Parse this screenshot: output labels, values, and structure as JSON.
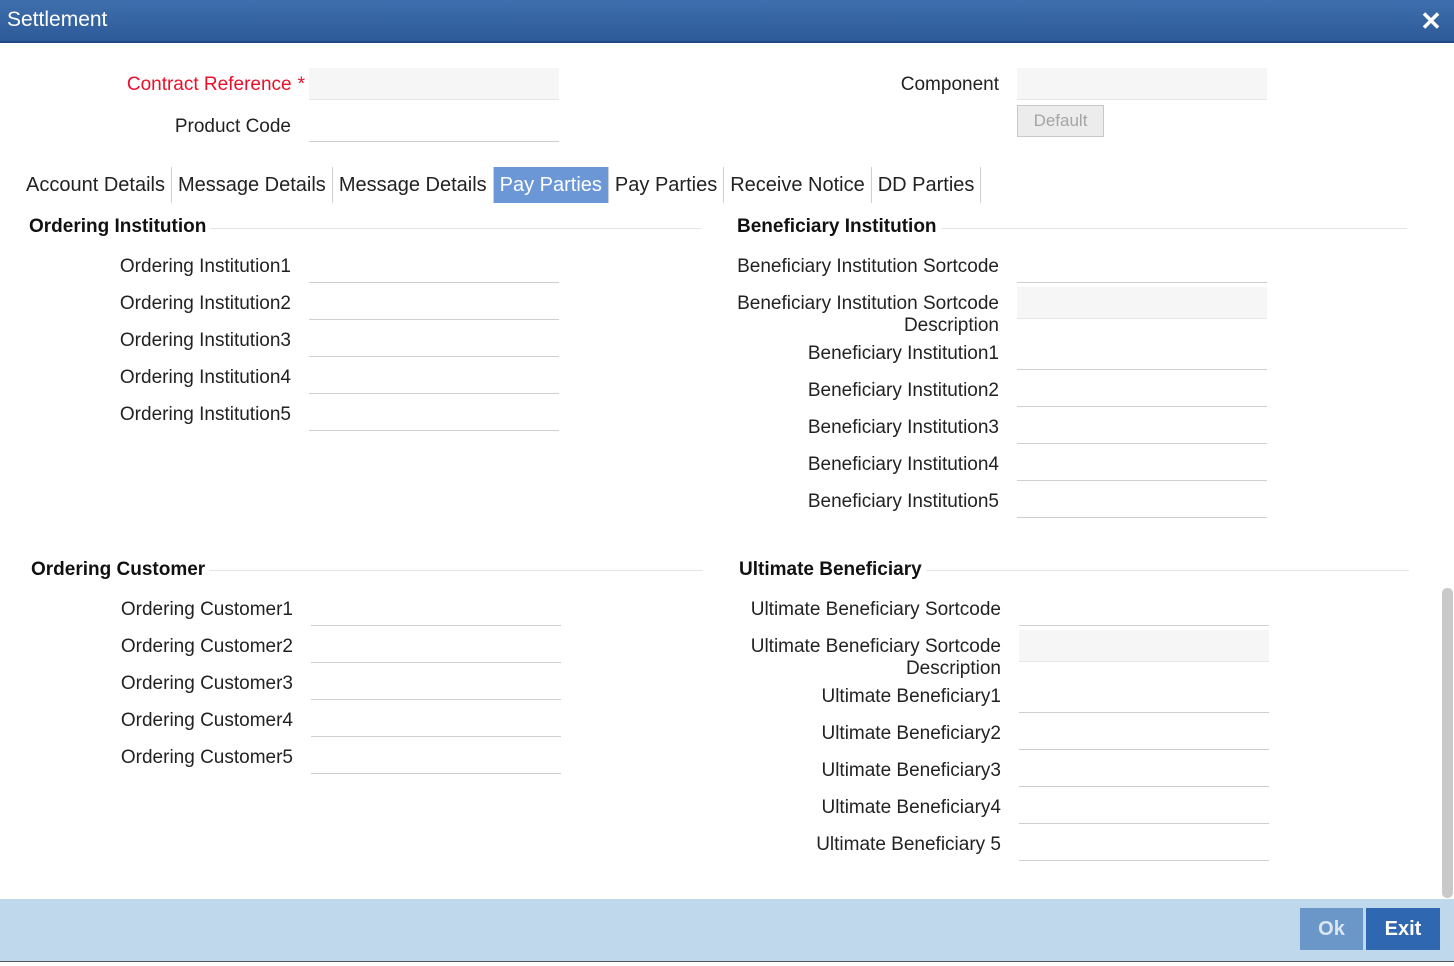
{
  "window": {
    "title": "Settlement",
    "close_glyph": "✕"
  },
  "header": {
    "contract_reference_label": "Contract Reference",
    "required_mark": "*",
    "product_code_label": "Product Code",
    "component_label": "Component",
    "default_button": "Default"
  },
  "tabs": [
    {
      "label": "Account Details"
    },
    {
      "label": "Message Details"
    },
    {
      "label": "Message Details"
    },
    {
      "label": "Pay Parties"
    },
    {
      "label": "Pay Parties"
    },
    {
      "label": "Receive Notice"
    },
    {
      "label": "DD Parties"
    }
  ],
  "ordering_institution": {
    "title": "Ordering Institution",
    "fields": [
      "Ordering Institution1",
      "Ordering Institution2",
      "Ordering Institution3",
      "Ordering Institution4",
      "Ordering Institution5"
    ]
  },
  "beneficiary_institution": {
    "title": "Beneficiary Institution",
    "sortcode": "Beneficiary Institution Sortcode",
    "sortcode_desc_line1": "Beneficiary Institution Sortcode",
    "sortcode_desc_line2": "Description",
    "fields": [
      "Beneficiary Institution1",
      "Beneficiary Institution2",
      "Beneficiary Institution3",
      "Beneficiary Institution4",
      "Beneficiary Institution5"
    ]
  },
  "ordering_customer": {
    "title": "Ordering Customer",
    "fields": [
      "Ordering Customer1",
      "Ordering Customer2",
      "Ordering Customer3",
      "Ordering Customer4",
      "Ordering Customer5"
    ]
  },
  "ultimate_beneficiary": {
    "title": "Ultimate Beneficiary",
    "sortcode": "Ultimate Beneficiary Sortcode",
    "sortcode_desc_line1": "Ultimate Beneficiary Sortcode",
    "sortcode_desc_line2": "Description",
    "fields": [
      "Ultimate Beneficiary1",
      "Ultimate Beneficiary2",
      "Ultimate Beneficiary3",
      "Ultimate Beneficiary4",
      "Ultimate Beneficiary 5"
    ]
  },
  "footer": {
    "ok": "Ok",
    "exit": "Exit"
  }
}
